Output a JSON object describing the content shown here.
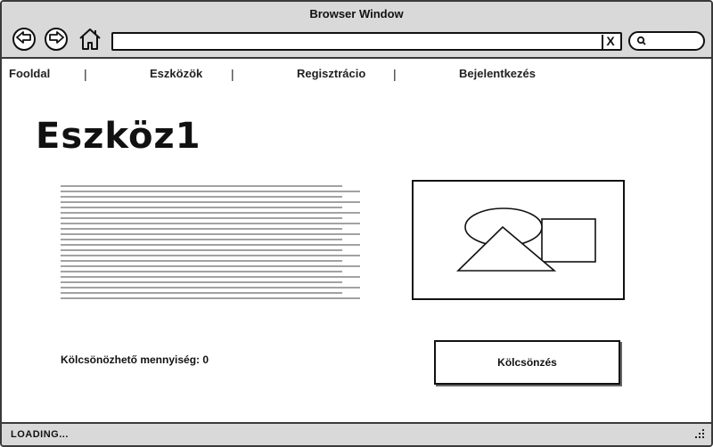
{
  "window": {
    "title": "Browser Window"
  },
  "toolbar": {
    "address_value": "",
    "clear_label": "X",
    "search_value": "",
    "icons": [
      "back-arrow-icon",
      "forward-arrow-icon",
      "home-icon",
      "search-icon"
    ]
  },
  "menu": {
    "items": [
      {
        "label": "Fooldal"
      },
      {
        "label": "Eszközök"
      },
      {
        "label": "Regisztrácio"
      },
      {
        "label": "Bejelentkezés"
      }
    ],
    "separator": "|"
  },
  "page": {
    "title": "Eszköz1",
    "quantity_label": "Kölcsönözhető mennyiség: 0",
    "borrow_button": "Kölcsönzés"
  },
  "status": {
    "text": "LOADING..."
  },
  "colors": {
    "chrome": "#d9d9d9",
    "border": "#3a3a3a",
    "ink": "#111111"
  }
}
